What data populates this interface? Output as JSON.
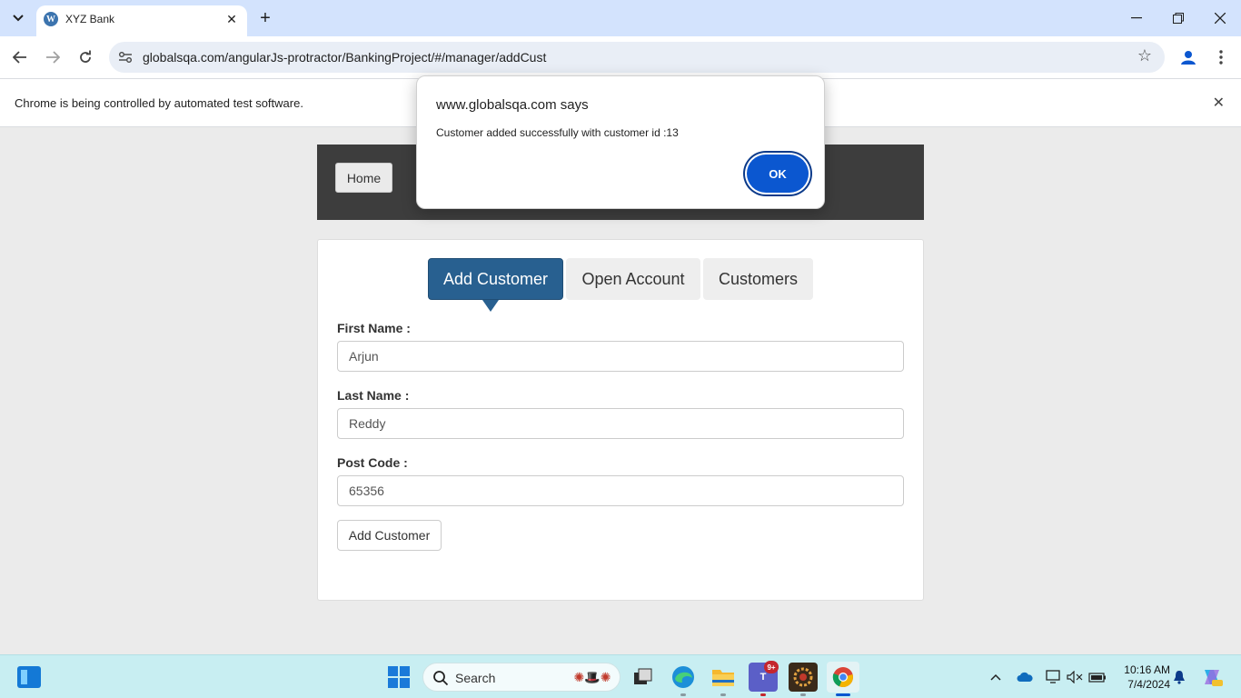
{
  "browser": {
    "tab_title": "XYZ Bank",
    "url": "globalsqa.com/angularJs-protractor/BankingProject/#/manager/addCust",
    "infobar_text": "Chrome is being controlled by automated test software."
  },
  "page": {
    "home_label": "Home",
    "tabs": [
      {
        "label": "Add Customer",
        "active": true
      },
      {
        "label": "Open Account",
        "active": false
      },
      {
        "label": "Customers",
        "active": false
      }
    ],
    "form": {
      "first_name_label": "First Name :",
      "first_name_value": "Arjun",
      "last_name_label": "Last Name :",
      "last_name_value": "Reddy",
      "post_code_label": "Post Code :",
      "post_code_value": "65356",
      "submit_label": "Add Customer"
    }
  },
  "dialog": {
    "title": "www.globalsqa.com says",
    "message": "Customer added successfully with customer id :13",
    "ok_label": "OK"
  },
  "taskbar": {
    "search_label": "Search",
    "teams_badge": "9+",
    "time": "10:16 AM",
    "date": "7/4/2024"
  },
  "colors": {
    "active_tab": "#286090",
    "header_bg": "#3d3d3d",
    "dialog_ok": "#0b57d0",
    "taskbar_bg": "#c8eef2"
  }
}
